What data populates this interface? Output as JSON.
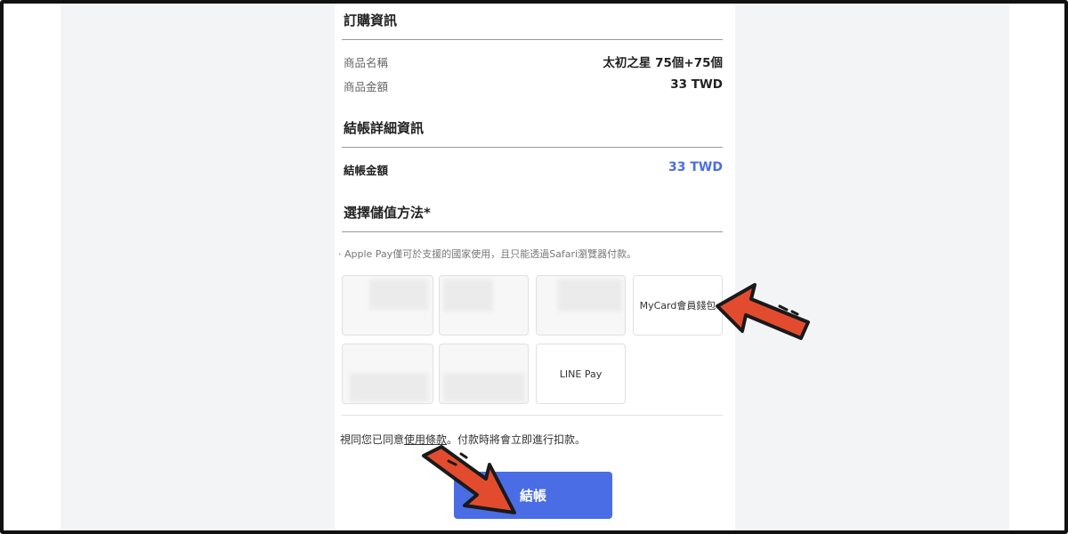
{
  "order_info": {
    "title": "訂購資訊",
    "product_name_label": "商品名稱",
    "product_name_value": "太初之星 75個+75個",
    "product_amount_label": "商品金額",
    "product_amount_value": "33 TWD"
  },
  "checkout_details": {
    "title": "結帳詳細資訊",
    "amount_label": "結帳金額",
    "amount_value": "33 TWD"
  },
  "payment": {
    "title": "選擇儲值方法*",
    "note": "· Apple Pay僅可於支援的國家使用，且只能透過Safari瀏覽器付款。",
    "options": [
      {
        "label": "MyCard會員錢包"
      },
      {
        "label": "LINE Pay"
      }
    ]
  },
  "agreement": {
    "prefix": "視同您已同意",
    "link": "使用條款",
    "suffix": "。付款時將會立即進行扣款。"
  },
  "checkout_button": {
    "label": "結帳"
  },
  "colors": {
    "accent": "#4a6de5",
    "arrow": "#e34b2f"
  }
}
